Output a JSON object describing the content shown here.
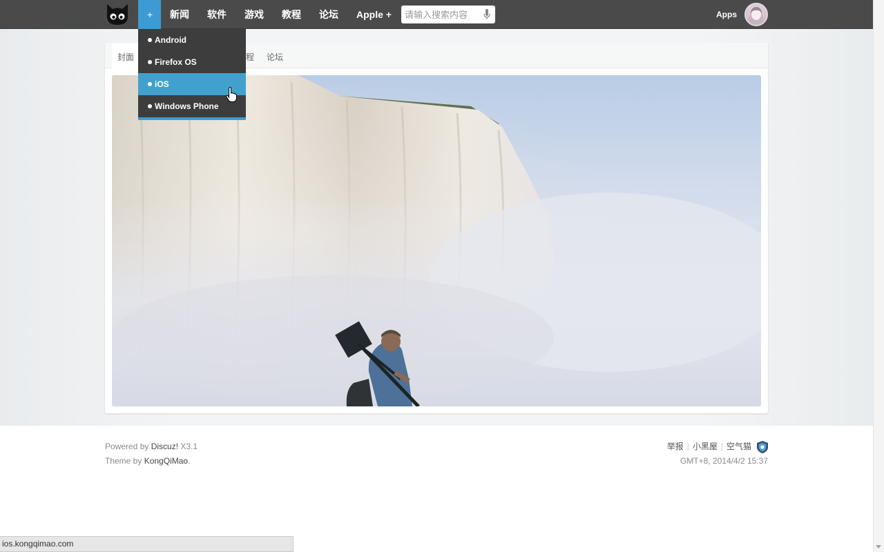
{
  "nav": {
    "plus_label": "+",
    "items": [
      {
        "label": "新闻"
      },
      {
        "label": "软件"
      },
      {
        "label": "游戏"
      },
      {
        "label": "教程"
      },
      {
        "label": "论坛"
      },
      {
        "label": "Apple +"
      }
    ],
    "search_placeholder": "请输入搜索内容",
    "apps_label": "Apps"
  },
  "dropdown": {
    "items": [
      {
        "label": "Android",
        "active": false
      },
      {
        "label": "Firefox OS",
        "active": false
      },
      {
        "label": "iOS",
        "active": true
      },
      {
        "label": "Windows Phone",
        "active": false
      }
    ]
  },
  "tabs": {
    "items": [
      {
        "label": "封面"
      },
      {
        "label": "程"
      },
      {
        "label": "论坛"
      }
    ]
  },
  "footer": {
    "powered_prefix": "Powered by ",
    "powered_link": "Discuz!",
    "powered_version": " X3.1",
    "theme_prefix": "Theme by ",
    "theme_link": "KongQiMao",
    "theme_suffix": ".",
    "links": [
      "举报",
      "小黑屋",
      "空气猫"
    ],
    "timestamp": "GMT+8, 2014/4/2 15:37"
  },
  "statusbar": {
    "url": "ios.kongqimao.com"
  },
  "colors": {
    "topbar": "#4a4a4a",
    "accent": "#3e9ad3",
    "dropdown_bg": "#3d3d3d",
    "dropdown_active": "#42a1cc"
  }
}
